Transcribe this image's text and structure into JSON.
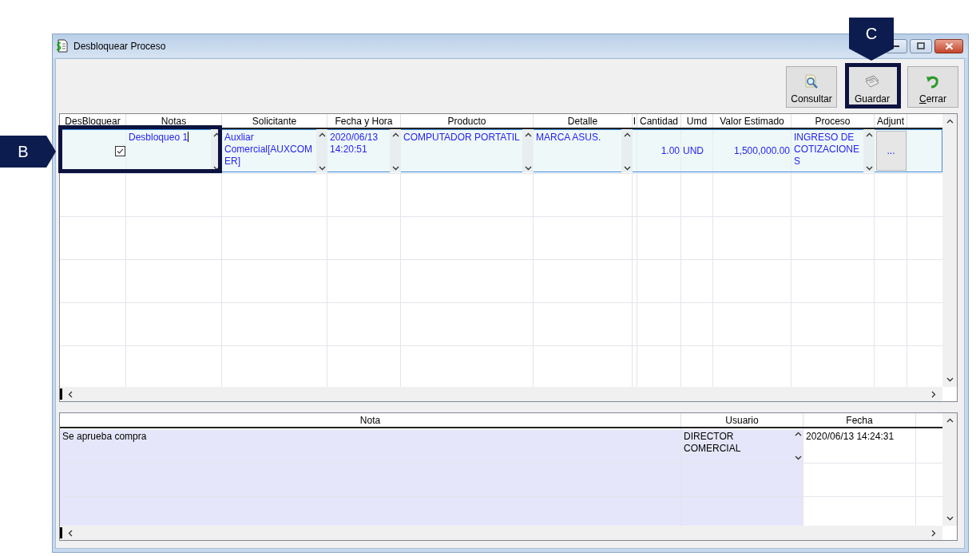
{
  "window": {
    "title": "Desbloquear Proceso"
  },
  "toolbar": [
    {
      "label": "Consultar",
      "kind": "search",
      "mnemonic": false
    },
    {
      "label": "Guardar",
      "kind": "save",
      "mnemonic": false
    },
    {
      "label": "Cerrar",
      "kind": "close",
      "mnemonic": true
    }
  ],
  "requests_table": {
    "columns": [
      "DesBloquear",
      "Notas",
      "Solicitante",
      "Fecha y Hora",
      "Producto",
      "Detalle",
      "I",
      "Cantidad",
      "Umd",
      "Valor Estimado",
      "Proceso",
      "Adjunt"
    ],
    "rows": [
      {
        "selected": true,
        "cells": [
          {
            "kind": "checkbox",
            "checked": true
          },
          {
            "kind": "memo",
            "text": "Desbloqueo 1",
            "editing": true
          },
          {
            "kind": "memo",
            "text": "Auxliar Comercial[AUXCOMER]",
            "editing": false
          },
          {
            "kind": "memo",
            "text": "2020/06/13 14:20:51",
            "editing": false
          },
          {
            "kind": "memo",
            "text": "COMPUTADOR PORTATIL",
            "editing": false
          },
          {
            "kind": "memo",
            "text": "MARCA ASUS.",
            "editing": false
          },
          {
            "kind": "empty"
          },
          {
            "kind": "number",
            "text": "1.00"
          },
          {
            "kind": "text",
            "text": "UND"
          },
          {
            "kind": "number",
            "text": "1,500,000.00"
          },
          {
            "kind": "memo",
            "text": "INGRESO DE COTIZACIONES",
            "editing": false
          },
          {
            "kind": "button",
            "text": "..."
          }
        ]
      }
    ]
  },
  "notes_table": {
    "columns": [
      "Nota",
      "Usuario",
      "Fecha"
    ],
    "rows": [
      {
        "cells": [
          {
            "kind": "text",
            "text": "Se aprueba compra"
          },
          {
            "kind": "memo",
            "text": "DIRECTOR COMERCIAL",
            "editing": false
          },
          {
            "kind": "text",
            "text": "2020/06/13 14:24:31"
          }
        ]
      }
    ]
  },
  "annotations": [
    {
      "label": "B",
      "kind": "left"
    },
    {
      "label": "C",
      "kind": "down"
    }
  ]
}
